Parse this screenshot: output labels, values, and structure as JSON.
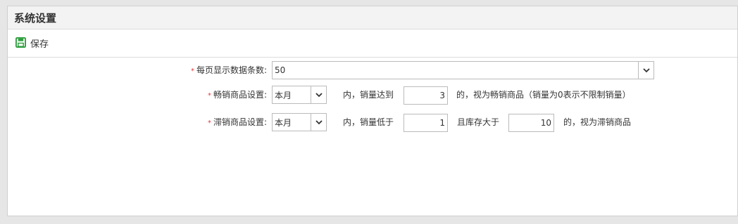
{
  "header": {
    "title": "系统设置"
  },
  "toolbar": {
    "save_label": "保存",
    "save_icon": "floppy-disk-icon"
  },
  "form": {
    "page_size": {
      "label": "每页显示数据条数:",
      "value": "50"
    },
    "bestseller": {
      "label": "畅销商品设置:",
      "period": "本月",
      "text_within": "内，销量达到",
      "threshold": "3",
      "suffix": "的，视为畅销商品（销量为0表示不限制销量）"
    },
    "slowseller": {
      "label": "滞销商品设置:",
      "period": "本月",
      "text_within": "内，销量低于",
      "threshold": "1",
      "text_stock": "且库存大于",
      "stock": "10",
      "suffix": "的，视为滞销商品"
    }
  },
  "colors": {
    "required": "#e4393c",
    "save_icon": "#2e9e3e"
  }
}
